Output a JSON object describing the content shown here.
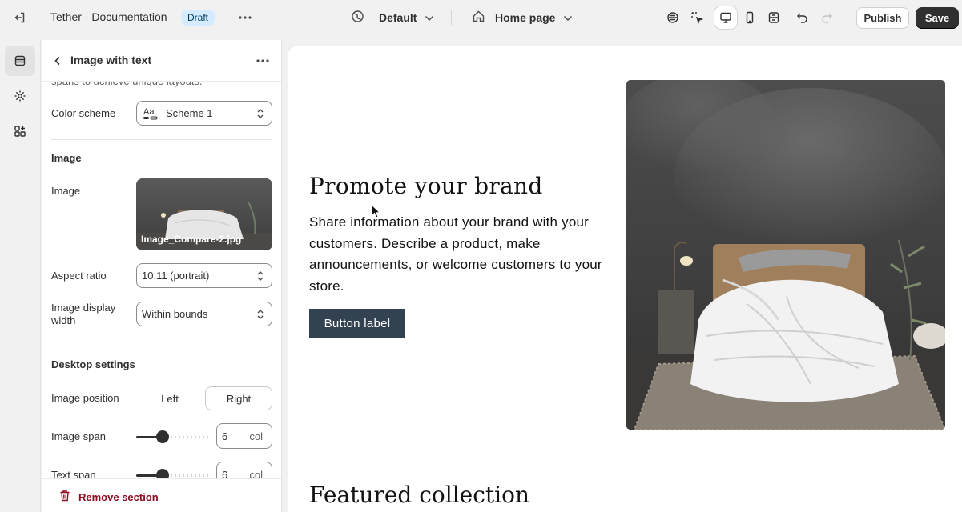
{
  "topbar": {
    "theme_name": "Tether - Documentation",
    "badge": "Draft",
    "context": "Default",
    "page": "Home page",
    "publish_label": "Publish",
    "save_label": "Save"
  },
  "panel": {
    "title": "Image with text",
    "cut_text": "spans to achieve unique layouts.",
    "color_scheme_label": "Color scheme",
    "color_scheme_value": "Scheme 1",
    "image_section": "Image",
    "image_label": "Image",
    "image_filename": "Image_Compare-2.jpg",
    "aspect_ratio_label": "Aspect ratio",
    "aspect_ratio_value": "10:11 (portrait)",
    "display_width_label_1": "Image display",
    "display_width_label_2": "width",
    "display_width_value": "Within bounds",
    "desktop_section": "Desktop settings",
    "image_position_label": "Image position",
    "position_left": "Left",
    "position_right": "Right",
    "image_span_label": "Image span",
    "image_span_value": "6",
    "text_span_label": "Text span",
    "text_span_value": "6",
    "unit": "col",
    "remove_label": "Remove section"
  },
  "preview": {
    "heading": "Promote your brand",
    "body": "Share information about your brand with your customers. Describe a product, make announcements, or welcome customers to your store.",
    "button": "Button label",
    "next_heading": "Featured collection"
  },
  "colors": {
    "accent_button": "#334251",
    "save_button": "#303030",
    "danger": "#8e0b21",
    "draft_badge": "#d5ebff"
  }
}
